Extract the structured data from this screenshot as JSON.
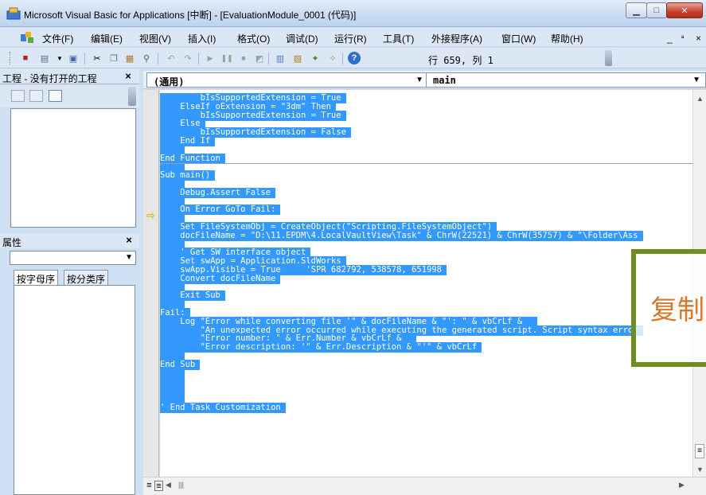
{
  "window": {
    "title": "Microsoft Visual Basic for Applications [中断] - [EvaluationModule_0001 (代码)]",
    "app_icon": "vba-icon",
    "controls": [
      "minimize-icon",
      "maximize-icon",
      "close-icon"
    ]
  },
  "menubar": {
    "icon": "vba-window-icon",
    "items": [
      "文件(F)",
      "编辑(E)",
      "视图(V)",
      "插入(I)",
      "格式(O)",
      "调试(D)",
      "运行(R)",
      "工具(T)",
      "外接程序(A)",
      "窗口(W)",
      "帮助(H)"
    ],
    "mdi_min": "_",
    "mdi_restore": "ª",
    "mdi_close": "×"
  },
  "toolbar": {
    "position": "行 659, 列 1"
  },
  "project_pane": {
    "title": "工程 - 没有打开的工程",
    "close": "×"
  },
  "properties_pane": {
    "title": "属性",
    "close": "×",
    "tab_alpha": "按字母序",
    "tab_category": "按分类序"
  },
  "code_window": {
    "object_combo": "(通用)",
    "procedure_combo": "main",
    "lines": [
      "        bIsSupportedExtension = True",
      "    ElseIf oExtension = \"3dm\" Then",
      "        bIsSupportedExtension = True",
      "    Else",
      "        bIsSupportedExtension = False",
      "    End If",
      "",
      "End Function",
      "",
      "Sub main()",
      "",
      "    Debug.Assert False",
      "",
      "    On Error GoTo Fail:",
      "",
      "    Set FileSystemObj = CreateObject(\"Scripting.FileSystemObject\")",
      "    docFileName = \"D:\\11.EPDM\\4.LocalVaultView\\Task\" & ChrW(22521) & ChrW(35757) & \"\\Folder\\Ass",
      "",
      "    ' Get SW interface object",
      "    Set swApp = Application.SldWorks",
      "    swApp.Visible = True     'SPR 682792, 538578, 651998",
      "    Convert docFileName",
      "",
      "    Exit Sub",
      "",
      "Fail:",
      "    Log \"Error while converting file '\" & docFileName & \"': \" & vbCrLf & _",
      "        \"An unexpected error occurred while executing the generated script. Script syntax error",
      "        \"Error number: \" & Err.Number & vbCrLf & _",
      "        \"Error description: '\" & Err.Description & \"'\" & vbCrLf",
      "",
      "End Sub",
      "",
      "",
      "",
      "",
      "' End Task Customization"
    ]
  },
  "overlay": {
    "text": "复制"
  }
}
